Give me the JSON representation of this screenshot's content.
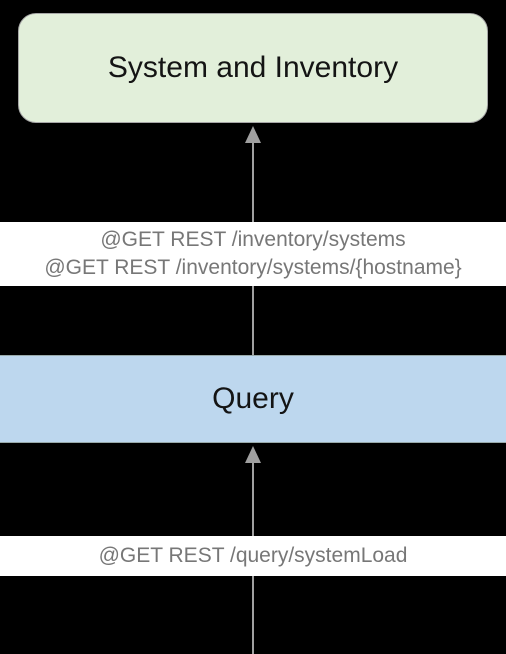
{
  "nodes": {
    "system_inventory": {
      "label": "System and Inventory"
    },
    "query": {
      "label": "Query"
    }
  },
  "edges": {
    "inventory_calls": {
      "line1": "@GET REST /inventory/systems",
      "line2": "@GET REST /inventory/systems/{hostname}"
    },
    "query_calls": {
      "line1": "@GET REST /query/systemLoad"
    }
  }
}
